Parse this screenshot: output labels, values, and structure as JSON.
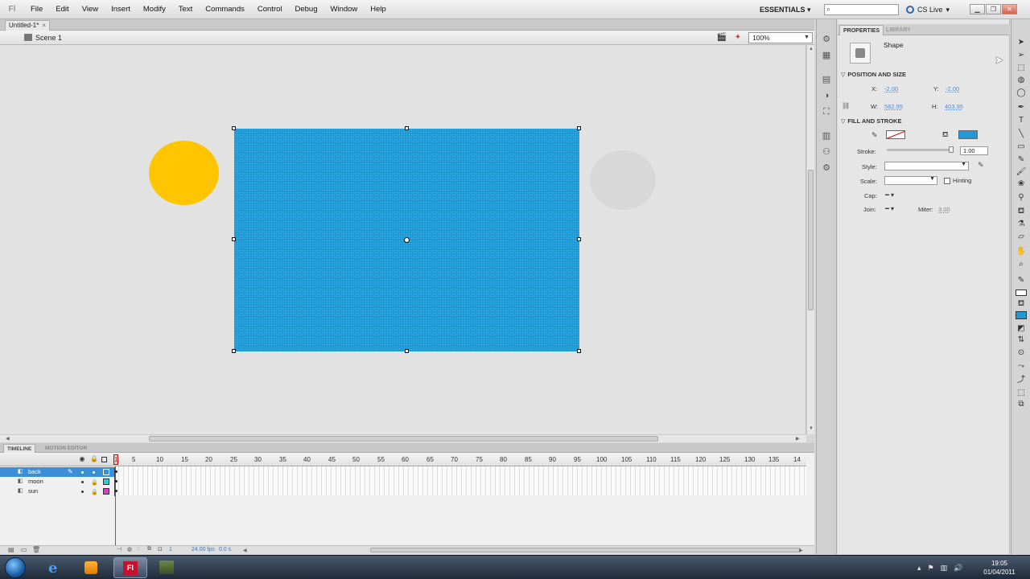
{
  "menubar": {
    "app_logo": "Fl",
    "items": [
      "File",
      "Edit",
      "View",
      "Insert",
      "Modify",
      "Text",
      "Commands",
      "Control",
      "Debug",
      "Window",
      "Help"
    ],
    "workspace": "ESSENTIALS ▾",
    "search_placeholder": "",
    "cslive": "CS Live",
    "cslive_arrow": "▾"
  },
  "document": {
    "tab_title": "Untitled-1*",
    "tab_close": "×",
    "scene": "Scene 1",
    "zoom": "100%"
  },
  "stage": {
    "rect_color": "#1e9ad6",
    "sun_color": "#ffc500",
    "moon_color": "#d8d8d8"
  },
  "timeline": {
    "tabs": [
      "TIMELINE",
      "MOTION EDITOR"
    ],
    "frame_numbers": [
      "1",
      "5",
      "10",
      "15",
      "20",
      "25",
      "30",
      "35",
      "40",
      "45",
      "50",
      "55",
      "60",
      "65",
      "70",
      "75",
      "80",
      "85",
      "90",
      "95",
      "100",
      "105",
      "110",
      "115",
      "120",
      "125",
      "130",
      "135",
      "14"
    ],
    "layers": [
      {
        "name": "back",
        "color": "#3a8fd8",
        "selected": true
      },
      {
        "name": "moon",
        "color": "#33cccc",
        "selected": false
      },
      {
        "name": "sun",
        "color": "#cc44cc",
        "selected": false
      }
    ],
    "fps": "24.00 fps",
    "time": "0.0 s",
    "current_frame": "1"
  },
  "properties": {
    "tabs": [
      "PROPERTIES",
      "LIBRARY"
    ],
    "object_type": "Shape",
    "position_size": {
      "heading": "POSITION AND SIZE",
      "x_label": "X:",
      "x_value": "-2.00",
      "y_label": "Y:",
      "y_value": "-2.00",
      "w_label": "W:",
      "w_value": "562.95",
      "h_label": "H:",
      "h_value": "403.95"
    },
    "fill_stroke": {
      "heading": "FILL AND STROKE",
      "fill_color": "#1e9ad6",
      "stroke_label": "Stroke:",
      "stroke_value": "1.00",
      "style_label": "Style:",
      "scale_label": "Scale:",
      "hinting_label": "Hinting",
      "cap_label": "Cap:",
      "join_label": "Join:",
      "miter_label": "Miter:",
      "miter_value": "3.00"
    }
  },
  "taskbar": {
    "flash_label": "Fl",
    "ie_label": "e",
    "clock_time": "19:05",
    "clock_date": "01/04/2011"
  }
}
